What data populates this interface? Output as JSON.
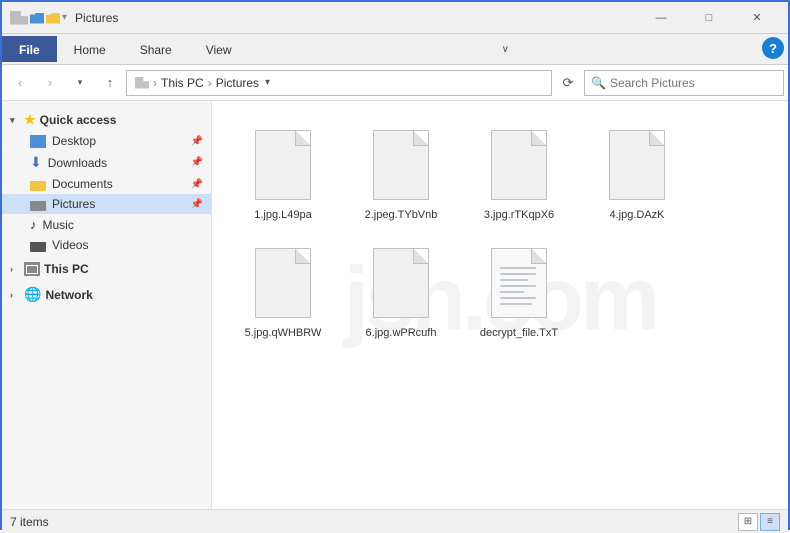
{
  "titleBar": {
    "title": "Pictures",
    "minimizeLabel": "—",
    "maximizeLabel": "□",
    "closeLabel": "✕"
  },
  "ribbon": {
    "tabs": [
      "File",
      "Home",
      "Share",
      "View"
    ],
    "activeTab": "File",
    "chevronLabel": "∨",
    "helpLabel": "?"
  },
  "addressBar": {
    "backLabel": "‹",
    "forwardLabel": "›",
    "upLabel": "↑",
    "recentLabel": "∨",
    "path": [
      "This PC",
      "Pictures"
    ],
    "pathDropLabel": "∨",
    "refreshLabel": "⟳",
    "searchPlaceholder": "Search Pictures"
  },
  "sidebar": {
    "quickAccess": {
      "label": "Quick access",
      "expanded": true,
      "items": [
        {
          "name": "Desktop",
          "type": "desktop",
          "pinned": true
        },
        {
          "name": "Downloads",
          "type": "download",
          "pinned": true
        },
        {
          "name": "Documents",
          "type": "folder",
          "pinned": true
        },
        {
          "name": "Pictures",
          "type": "pictures",
          "pinned": true,
          "active": true
        },
        {
          "name": "Music",
          "type": "music",
          "pinned": false
        },
        {
          "name": "Videos",
          "type": "video",
          "pinned": false
        }
      ]
    },
    "thisPC": {
      "label": "This PC",
      "expanded": false
    },
    "network": {
      "label": "Network",
      "expanded": false
    }
  },
  "files": [
    {
      "id": 1,
      "name": "1.jpg.L49pa",
      "type": "image"
    },
    {
      "id": 2,
      "name": "2.jpeg.TYbVnb",
      "type": "image"
    },
    {
      "id": 3,
      "name": "3.jpg.rTKqpX6",
      "type": "image"
    },
    {
      "id": 4,
      "name": "4.jpg.DAzK",
      "type": "image"
    },
    {
      "id": 5,
      "name": "5.jpg.qWHBRW",
      "type": "image"
    },
    {
      "id": 6,
      "name": "6.jpg.wPRcufh",
      "type": "image"
    },
    {
      "id": 7,
      "name": "decrypt_file.TxT",
      "type": "text"
    }
  ],
  "statusBar": {
    "itemCount": "7 items",
    "viewGrid": "⊞",
    "viewList": "≡"
  },
  "watermark": "jsh.com"
}
